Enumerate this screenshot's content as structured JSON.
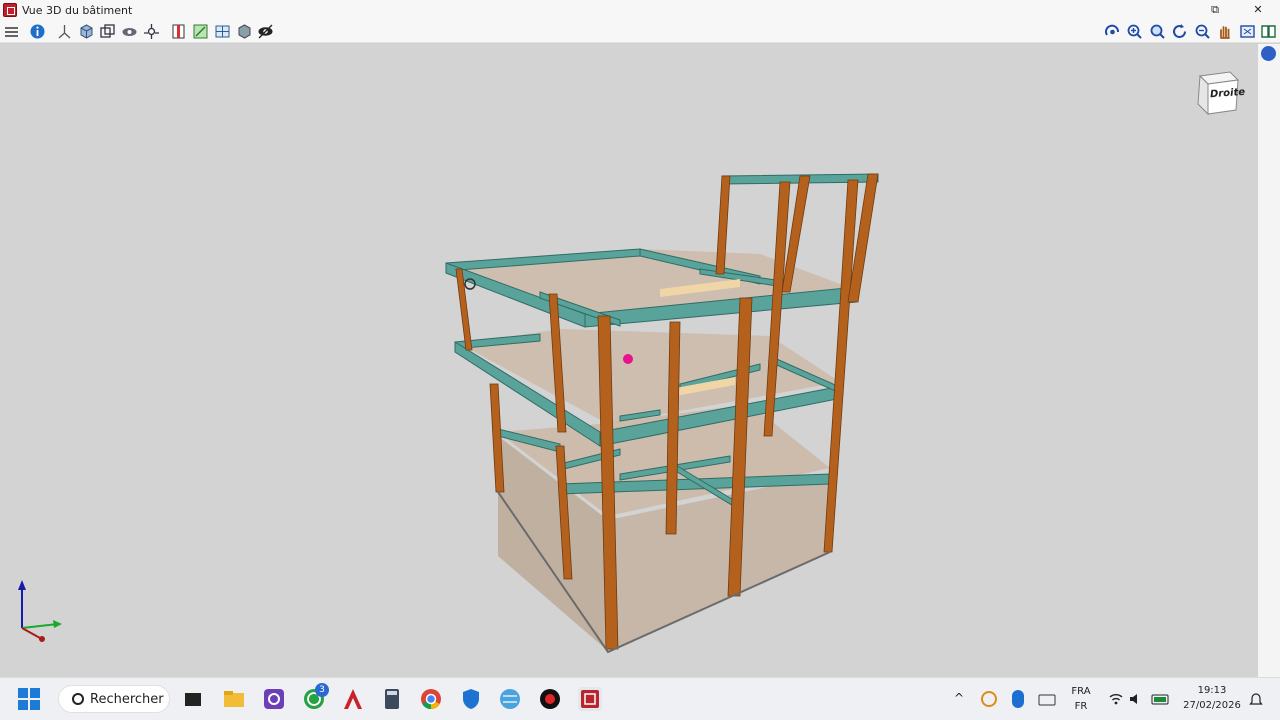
{
  "window": {
    "title": "Vue 3D du bâtiment",
    "controls": {
      "restore": "⧉",
      "close": "✕"
    }
  },
  "toolbar_left": [
    {
      "name": "layers-icon"
    },
    {
      "name": "info-icon"
    },
    {
      "name": "axis-icon"
    },
    {
      "name": "shade-box-icon"
    },
    {
      "name": "frame-box-icon"
    },
    {
      "name": "eye-scope-icon"
    },
    {
      "name": "orbit-node-icon"
    },
    {
      "name": "section-red-icon"
    },
    {
      "name": "section-green-icon"
    },
    {
      "name": "plan-grid-icon"
    },
    {
      "name": "solid-cube-icon"
    },
    {
      "name": "visibility-eye-icon"
    }
  ],
  "toolbar_right": [
    {
      "name": "rotate-view-icon"
    },
    {
      "name": "zoom-extents-icon"
    },
    {
      "name": "zoom-window-icon"
    },
    {
      "name": "refresh-view-icon"
    },
    {
      "name": "zoom-out-icon"
    },
    {
      "name": "pan-hand-icon"
    },
    {
      "name": "fit-window-icon"
    },
    {
      "name": "book-help-icon"
    }
  ],
  "navcube": {
    "face_label": "Droite"
  },
  "colors": {
    "viewport_bg": "#d3d3d3",
    "column": "#b5611e",
    "beam": "#5aa39a",
    "slab": "#c8a98c",
    "accent_magenta": "#e8128e"
  },
  "taskbar": {
    "search_label": "Rechercher",
    "whatsapp_badge": "3",
    "language_top": "FRA",
    "language_bottom": "FR",
    "time": "19:13",
    "date": "27/02/2026"
  }
}
